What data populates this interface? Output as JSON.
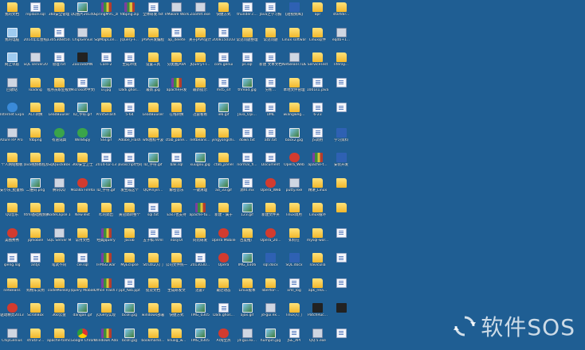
{
  "desktop": {
    "background": "#1f5e93",
    "columns": [
      [
        [
          "我的文档",
          "folder"
        ],
        [
          "我的电脑",
          "pc"
        ],
        [
          "网上邻居",
          "pc"
        ],
        [
          "回收站",
          "exe"
        ],
        [
          "Internet Explorer",
          "ie"
        ],
        [
          "Azure RP Pro 7.0",
          "exe"
        ],
        [
          "个人网站模板",
          "folder"
        ],
        [
          "安小乐_批量修改文件",
          "folder"
        ],
        [
          "QQ音乐",
          "folder"
        ],
        [
          "美图秀秀",
          "red"
        ],
        [
          "ipeng.log",
          "doc"
        ],
        [
          "netBeans",
          "folder"
        ],
        [
          "驱动精灵2013",
          "red"
        ],
        [
          "ChipGenius",
          "exe"
        ]
      ],
      [
        [
          "replace.sql",
          "doc"
        ],
        [
          "2014年年会照片分享",
          "folder"
        ],
        [
          "SQL server2008...",
          "exe"
        ],
        [
          "loading",
          "folder"
        ],
        [
          "ACI 转换",
          "folder"
        ],
        [
          "fdbpng",
          "folder"
        ],
        [
          "Java视频教程及讲义",
          "folder"
        ],
        [
          "二维码.png",
          "img"
        ],
        [
          "html基础视频教程",
          "folder"
        ],
        [
          "jqmobile",
          "folder"
        ],
        [
          "antjs",
          "doc"
        ],
        [
          "购物车实例",
          "folder"
        ],
        [
          "ScrollBox",
          "folder"
        ],
        [
          "strutz-2...",
          "folder"
        ]
      ],
      [
        [
          "360安全管理",
          "folder"
        ],
        [
          "1305308450...",
          "doc"
        ],
        [
          "管理.txt",
          "doc"
        ],
        [
          "程序员职业规划",
          "folder"
        ],
        [
          "LeadBuuser",
          "folder"
        ],
        [
          "有道词典",
          "green"
        ],
        [
          "SqlQuickBox",
          "folder"
        ],
        [
          "腾讯QQ",
          "exe"
        ],
        [
          "NodeClipse 10",
          "folder"
        ],
        [
          "SQL Server Manager",
          "exe"
        ],
        [
          "笔试不同",
          "folder"
        ],
        [
          "codeMonkey",
          "folder"
        ],
        [
          "360云盘",
          "folder"
        ],
        [
          "apache-tomcat",
          "folder"
        ]
      ],
      [
        [
          "QQ图片20140...",
          "img"
        ],
        [
          "ChipGenius",
          "exe"
        ],
        [
          "ZooTaskMN",
          "black"
        ],
        [
          "Microsoft中文版",
          "doc"
        ],
        [
          "ID_字符.gif",
          "img"
        ],
        [
          "Win8Spy",
          "green"
        ],
        [
          "360安全卫士",
          "folder"
        ],
        [
          "Mozilla Firefox",
          "red"
        ],
        [
          "NewText",
          "folder"
        ],
        [
          "常用文档",
          "folder"
        ],
        [
          "cie.sql",
          "doc"
        ],
        [
          "Jquery Mobile",
          "folder"
        ],
        [
          "dangan.gif",
          "img"
        ],
        [
          "Google Chrome",
          "chrome"
        ]
      ],
      [
        [
          "SpringMVC_zh.chm",
          "archive"
        ],
        [
          "SqlMapCon...",
          "folder"
        ],
        [
          "Care-2",
          "doc"
        ],
        [
          "ui.jpg",
          "img"
        ],
        [
          "PrintSFlash",
          "folder"
        ],
        [
          "SSI.gif",
          "img"
        ],
        [
          "2014-02-13",
          "doc"
        ],
        [
          "ID_字符.gif",
          "img"
        ],
        [
          "咋的调出",
          "folder"
        ],
        [
          "经典Jquery",
          "archive"
        ],
        [
          "IFMSG.war",
          "archive"
        ],
        [
          "Office Flash.rar",
          "archive"
        ],
        [
          "jQuery实现",
          "folder"
        ],
        [
          "Windows Adobe",
          "archive"
        ]
      ],
      [
        [
          "fdbpng.zip",
          "archive"
        ],
        [
          "JQuery-F...",
          "folder"
        ],
        [
          "生成环境",
          "doc"
        ],
        [
          "Dadi.ghos...",
          "doc"
        ],
        [
          "5-64",
          "doc"
        ],
        [
          "Adobe_Flash",
          "doc"
        ],
        [
          "javascript代码",
          "doc"
        ],
        [
          "发生成这个",
          "doc"
        ],
        [
          "黄冠调转整个",
          "folder"
        ],
        [
          "Jacob",
          "folder"
        ],
        [
          "MyEclipse",
          "folder"
        ],
        [
          "ppt_fwb.ppt",
          "doc"
        ],
        [
          "bcoll.jpg",
          "img"
        ],
        [
          "bcoll.jpg",
          "img"
        ]
      ],
      [
        [
          "全体研发.txt",
          "doc"
        ],
        [
          "JAVA开发编程",
          "folder"
        ],
        [
          "设置工具",
          "folder"
        ],
        [
          "最新.jpg",
          "img"
        ],
        [
          "LeadBuuser",
          "folder"
        ],
        [
          "wtk图标平波",
          "folder"
        ],
        [
          "ID_字符.gif",
          "img"
        ],
        [
          "QQPinyin...",
          "folder"
        ],
        [
          "sql.txt",
          "doc"
        ],
        [
          "五子棋.html",
          "doc"
        ],
        [
          "Struts2入门",
          "folder"
        ],
        [
          "提及文档",
          "folder"
        ],
        [
          "windows部署",
          "folder"
        ],
        [
          "bookmarks...",
          "folder"
        ]
      ],
      [
        [
          "VMware Workstation",
          "exe"
        ],
        [
          "ap_delete",
          "doc"
        ],
        [
          "分类图JAVA",
          "folder"
        ],
        [
          "apache开发",
          "archive"
        ],
        [
          "在线转换",
          "folder"
        ],
        [
          "ctab_pane...",
          "folder"
        ],
        [
          "bak.sql",
          "doc"
        ],
        [
          "解密音乐",
          "folder"
        ],
        [
          "Eas7也支持",
          "folder"
        ],
        [
          "easyUI",
          "doc"
        ],
        [
          "公司文件统一",
          "folder"
        ],
        [
          "生成研发文",
          "folder"
        ],
        [
          "快捷方式",
          "folder"
        ],
        [
          "linuxg_w...",
          "folder"
        ]
      ],
      [
        [
          "ZoomIt.exe",
          "exe"
        ],
        [
          "关于JAVA设计",
          "folder"
        ],
        [
          "JQuery-FI...",
          "folder"
        ],
        [
          "最新提示",
          "folder"
        ],
        [
          "迅雷看看",
          "folder"
        ],
        [
          "netbeans...",
          "folder"
        ],
        [
          "xuugou.jpg",
          "img"
        ],
        [
          "一键清理",
          "folder"
        ],
        [
          "apache-tu...",
          "archive"
        ],
        [
          "同比研发",
          "folder"
        ],
        [
          "2013030...",
          "doc"
        ],
        [
          "迅雷7",
          "folder"
        ],
        [
          "TMG_0305",
          "img"
        ],
        [
          "TMG_0305",
          "img"
        ]
      ],
      [
        [
          "快捷方式",
          "folder"
        ],
        [
          "2008150103",
          "doc"
        ],
        [
          "com.genui",
          "doc"
        ],
        [
          "md5_sif",
          "doc"
        ],
        [
          "ie6.gif",
          "img"
        ],
        [
          "yingyongshi...",
          "folder"
        ],
        [
          "ctab_panel",
          "folder"
        ],
        [
          "ad_33.gif",
          "img"
        ],
        [
          "新建 - 属于",
          "folder"
        ],
        [
          "Opera Mobile",
          "red"
        ],
        [
          "Opera",
          "red"
        ],
        [
          "最近动态",
          "folder"
        ],
        [
          "Dadi.ghos...",
          "doc"
        ],
        [
          "AI淘宝热",
          "red"
        ]
      ],
      [
        [
          "thunder.c...",
          "doc"
        ],
        [
          "常见问题整理",
          "folder"
        ],
        [
          "ps.sql",
          "doc"
        ],
        [
          "thread.jpg",
          "img"
        ],
        [
          "Java_Opi...",
          "doc"
        ],
        [
          "down.txt",
          "doc"
        ],
        [
          "normal_fl...",
          "doc"
        ],
        [
          "源ht.mx",
          "doc"
        ],
        [
          "123.gif",
          "img"
        ],
        [
          "百度推广",
          "folder"
        ],
        [
          "IMG_0306",
          "img"
        ],
        [
          "Linux版本",
          "folder"
        ],
        [
          "ajax.gif",
          "img"
        ],
        [
          "jd-gui.ex...",
          "exe"
        ]
      ],
      [
        [
          "Java之学习报",
          "doc"
        ],
        [
          "常见问题",
          "folder"
        ],
        [
          "新建 文本文档",
          "doc"
        ],
        [
          "分析...",
          "doc"
        ],
        [
          "UML",
          "doc"
        ],
        [
          "attr.txt",
          "doc"
        ],
        [
          "Document",
          "doc"
        ],
        [
          "Opera_Web",
          "red"
        ],
        [
          "新建文件夹",
          "folder"
        ],
        [
          "Opera_20...",
          "red"
        ],
        [
          "sql.docx",
          "word"
        ],
        [
          "libertor-...",
          "folder"
        ],
        [
          "jd-gui.ex...",
          "exe"
        ],
        [
          "humpin.jpg",
          "img"
        ]
      ],
      [
        [
          "【短视频库】",
          "word"
        ],
        [
          "Linux software",
          "folder"
        ],
        [
          "NetBeans IDE",
          "exe"
        ],
        [
          "本地文件管理",
          "folder"
        ],
        [
          "wiangweg...",
          "folder"
        ],
        [
          "back2.jpg",
          "img"
        ],
        [
          "Opera_Web",
          "red"
        ],
        [
          "putty.exe",
          "exe"
        ],
        [
          "linux调用",
          "folder"
        ],
        [
          "如何在",
          "folder"
        ],
        [
          "SQL.docx",
          "word"
        ],
        [
          "xml_log",
          "doc"
        ],
        [
          "linux入门",
          "folder"
        ],
        [
          "JSE_API",
          "doc"
        ]
      ],
      [
        [
          "apr",
          "folder"
        ],
        [
          "Linux软件",
          "folder"
        ],
        [
          "ServiceTest",
          "folder"
        ],
        [
          "1001s1.java",
          "doc"
        ],
        [
          "6-23",
          "doc"
        ],
        [
          "JS调用",
          "doc"
        ],
        [
          "apache-t...",
          "archive"
        ],
        [
          "精讲_Linux",
          "folder"
        ],
        [
          "Linux循环",
          "folder"
        ],
        [
          "mysql-wor...",
          "folder"
        ],
        [
          "naviculia",
          "folder"
        ],
        [
          "apk_rela...",
          "folder"
        ],
        [
          "PatchRuc...",
          "black"
        ],
        [
          "QQ:5.exe",
          "exe"
        ]
      ],
      [
        [
          "startdir...",
          "folder"
        ],
        [
          "eqdb+1...",
          "exe"
        ],
        [
          "liferay...",
          "folder"
        ],
        [
          "",
          "doc"
        ],
        [
          "",
          "doc"
        ],
        [
          "学习资料",
          "word"
        ],
        [
          "安装开发",
          "word"
        ],
        [
          "",
          "folder"
        ],
        [
          "",
          "folder"
        ],
        [
          "",
          "doc"
        ],
        [
          "",
          "doc"
        ],
        [
          "",
          "doc"
        ],
        [
          "",
          "black"
        ],
        [
          "",
          "doc"
        ]
      ]
    ]
  },
  "watermark": {
    "text": "软件SOS",
    "icon": "refresh-arrows-icon"
  }
}
